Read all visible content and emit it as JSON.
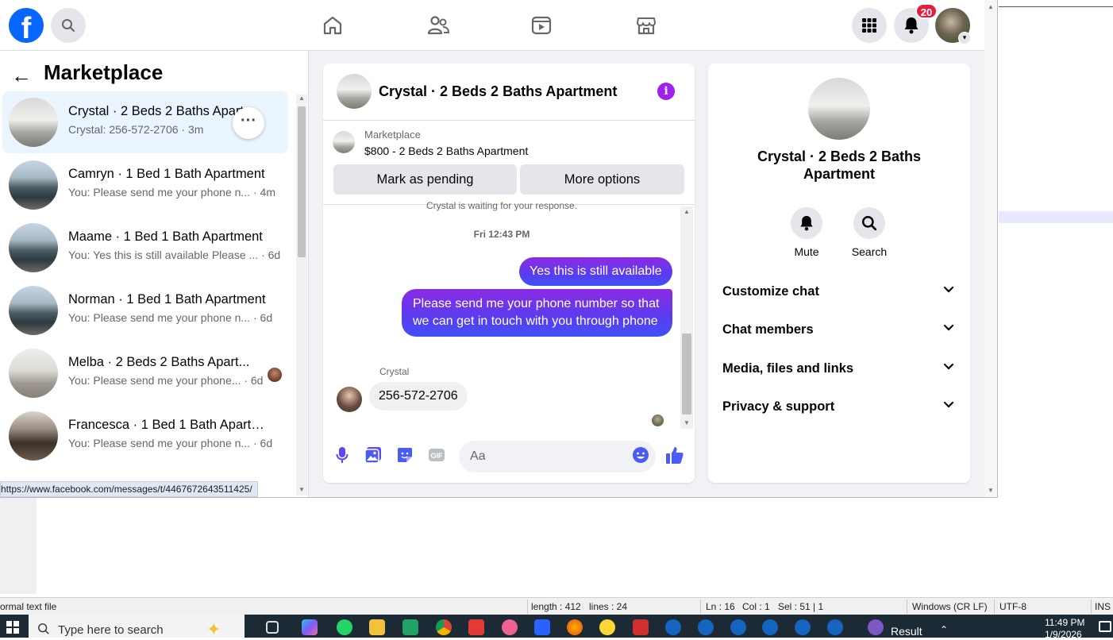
{
  "facebook": {
    "logo": "f",
    "notifications_count": "20",
    "left_panel": {
      "title": "Marketplace",
      "url_tooltip": "https://www.facebook.com/messages/t/4467672643511425/",
      "conversations": [
        {
          "name": "Crystal · 2 Beds 2 Baths Apartment",
          "preview": "Crystal: 256-572-2706 · 3m",
          "thumb": "room"
        },
        {
          "name": "Camryn · 1 Bed 1 Bath Apartment",
          "preview": "You: Please send me your phone n... · 4m",
          "thumb": "house"
        },
        {
          "name": "Maame · 1 Bed 1 Bath Apartment",
          "preview": "You: Yes this is still available Please ... · 6d",
          "thumb": "house"
        },
        {
          "name": "Norman · 1 Bed 1 Bath Apartment",
          "preview": "You: Please send me your phone n... · 6d",
          "thumb": "house"
        },
        {
          "name": "Melba · 2 Beds 2 Baths Apart...",
          "preview": "You: Please send me your phone... · 6d",
          "thumb": "fan"
        },
        {
          "name": "Francesca · 1 Bed 1 Bath Apartm...",
          "preview": "You: Please send me your phone n... · 6d",
          "thumb": "kitchen"
        }
      ]
    },
    "chat": {
      "title": "Crystal · 2 Beds 2 Baths Apartment",
      "info_glyph": "i",
      "listing_label": "Marketplace",
      "listing_price": "$800 - 2 Beds 2 Baths Apartment",
      "mark_pending_label": "Mark as pending",
      "more_options_label": "More options",
      "waiting_text": "Crystal is waiting for your response.",
      "timestamp": "Fri 12:43 PM",
      "messages_out": [
        "Yes this is still available",
        "Please send me your phone  number so that we can get in touch with you through phone"
      ],
      "sender_name": "Crystal",
      "message_in": "256-572-2706",
      "composer_placeholder": "Aa"
    },
    "info_panel": {
      "name": "Crystal · 2 Beds 2 Baths Apartment",
      "actions": [
        {
          "label": "Mute",
          "icon": "bell-icon"
        },
        {
          "label": "Search",
          "icon": "search-icon"
        }
      ],
      "sections": [
        "Customize chat",
        "Chat members",
        "Media, files and links",
        "Privacy & support"
      ]
    },
    "colors": {
      "brand": "#0866ff",
      "messenger_purple": "#a020f0",
      "out_bubble_start": "#8a2be2",
      "out_bubble_end": "#3f51f7",
      "badge": "#e41e3f"
    }
  },
  "editor_status": {
    "file_type": "ormal text file",
    "length": "length : 412",
    "lines": "lines : 24",
    "ln": "Ln : 16",
    "col": "Col : 1",
    "sel": "Sel : 51 | 1",
    "eol": "Windows (CR LF)",
    "encoding": "UTF-8",
    "mode": "INS"
  },
  "taskbar": {
    "search_placeholder": "Type here to search",
    "result_label": "Result",
    "time": "11:49 PM",
    "date": "1/9/2026"
  }
}
